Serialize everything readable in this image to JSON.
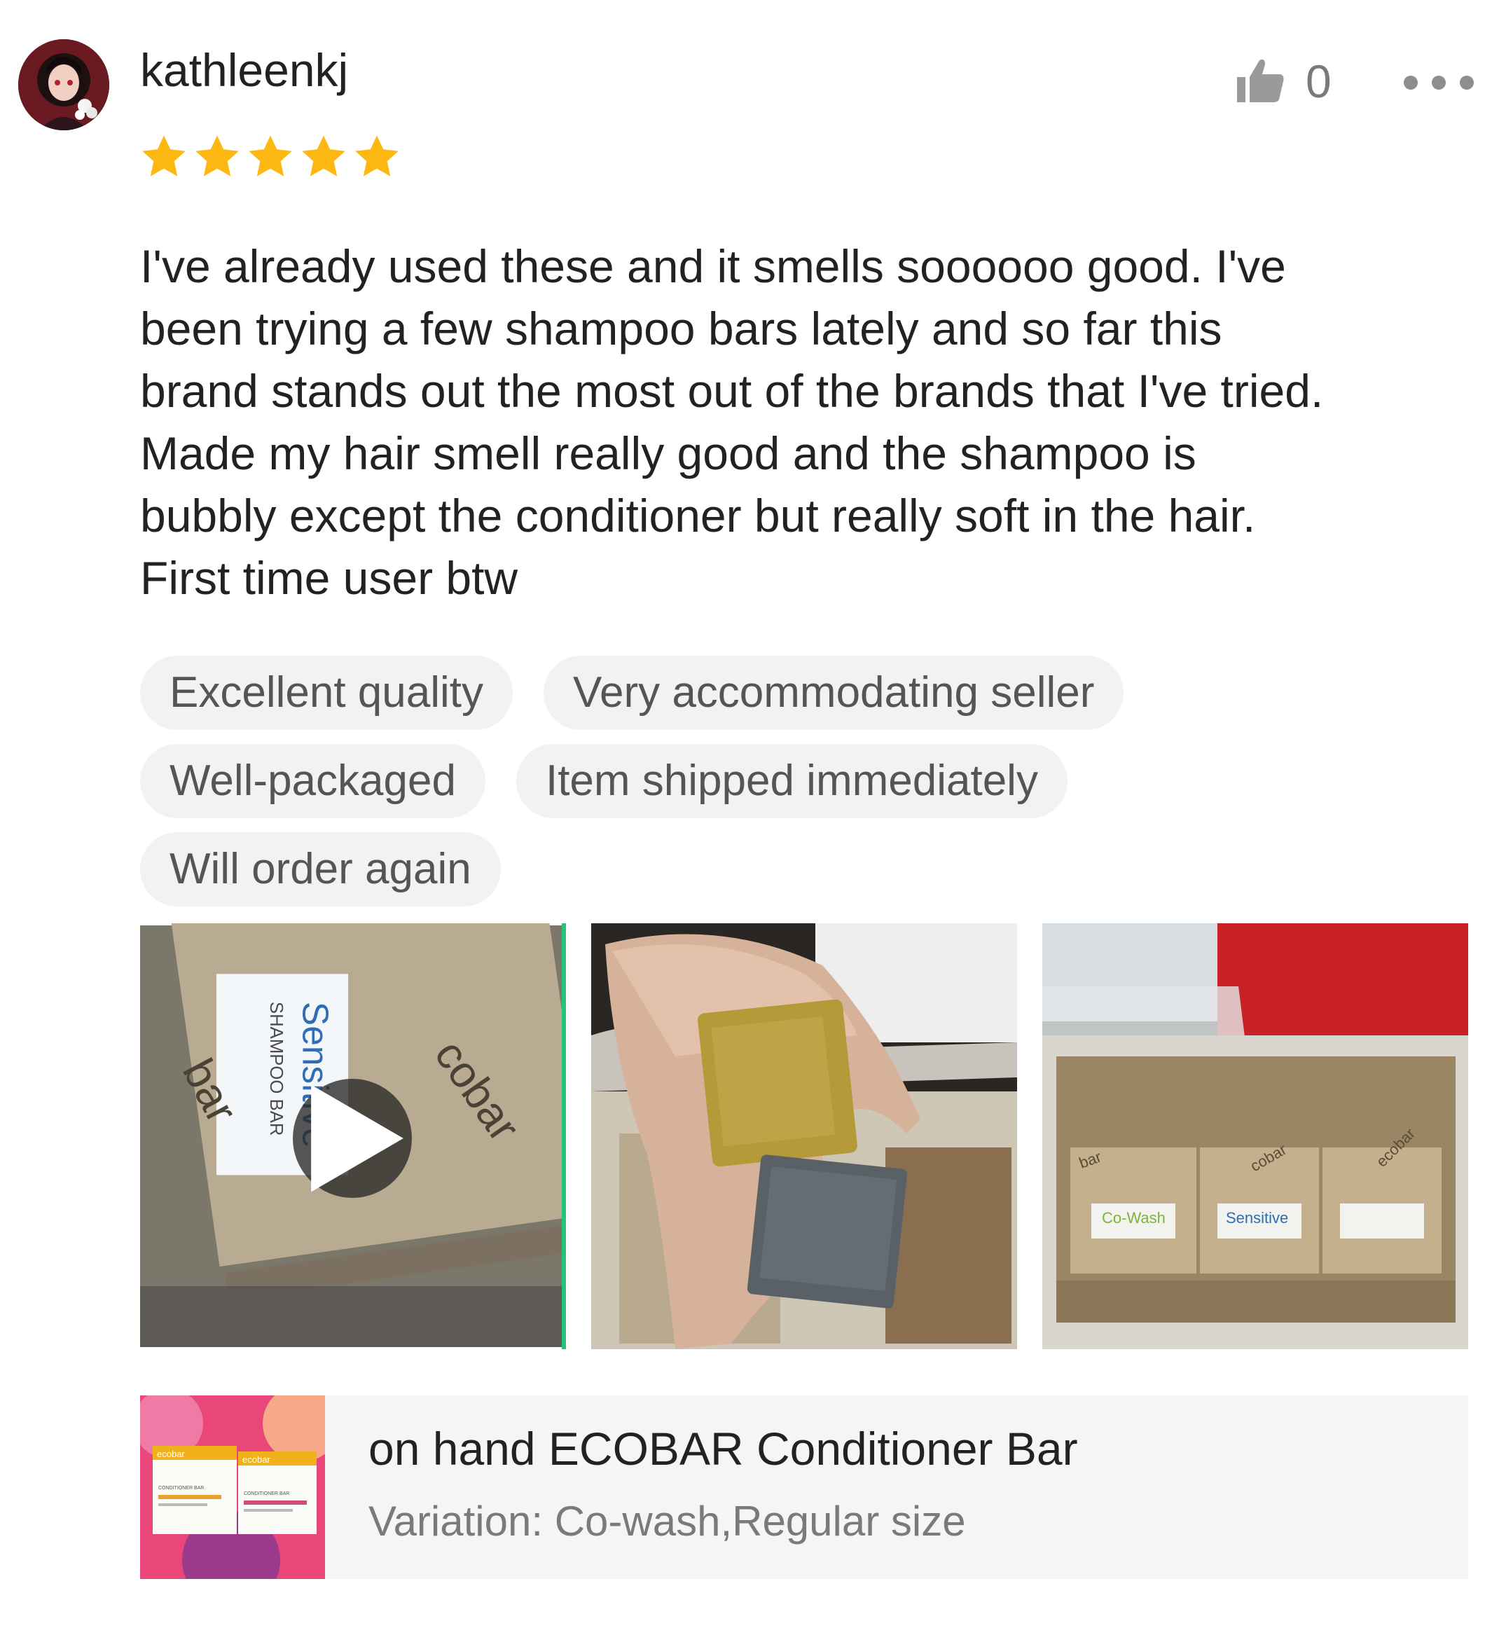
{
  "review": {
    "username": "kathleenkj",
    "rating": 5,
    "like_count": "0",
    "comment": "I've already used these and it smells soooooo good. I've\nbeen trying a few shampoo bars lately and so far this\nbrand stands out the most out of the brands that I've tried.\nMade my hair smell really good and the shampoo is\nbubbly except the conditioner but really soft in the hair.\nFirst time user btw",
    "tags": [
      [
        "Excellent quality",
        "Very accommodating seller"
      ],
      [
        "Well-packaged",
        "Item shipped immediately"
      ],
      [
        "Will order again"
      ]
    ],
    "media": [
      {
        "type": "video",
        "caption_text": [
          "Sensitive",
          "SHAMPOO BAR",
          "bar",
          "cobar"
        ]
      },
      {
        "type": "image"
      },
      {
        "type": "image",
        "caption_text": [
          "Co-Wash",
          "Sensitive",
          "bar",
          "cobar",
          "ecobar"
        ]
      }
    ],
    "product": {
      "name": "on hand ECOBAR Conditioner Bar",
      "variation": "Variation: Co-wash,Regular size",
      "thumb_text": [
        "ecobar",
        "ecobar",
        "CONDITIONER BAR",
        "CONDITIONER BAR"
      ]
    }
  },
  "colors": {
    "star": "#fdb813",
    "video_accent": "#26c47a",
    "tag_bg": "#f2f2f2",
    "card_bg": "#f5f5f5"
  },
  "icons": {
    "like": "thumbs-up-icon",
    "more": "more-dots-icon",
    "play": "play-icon",
    "star": "star-icon"
  }
}
